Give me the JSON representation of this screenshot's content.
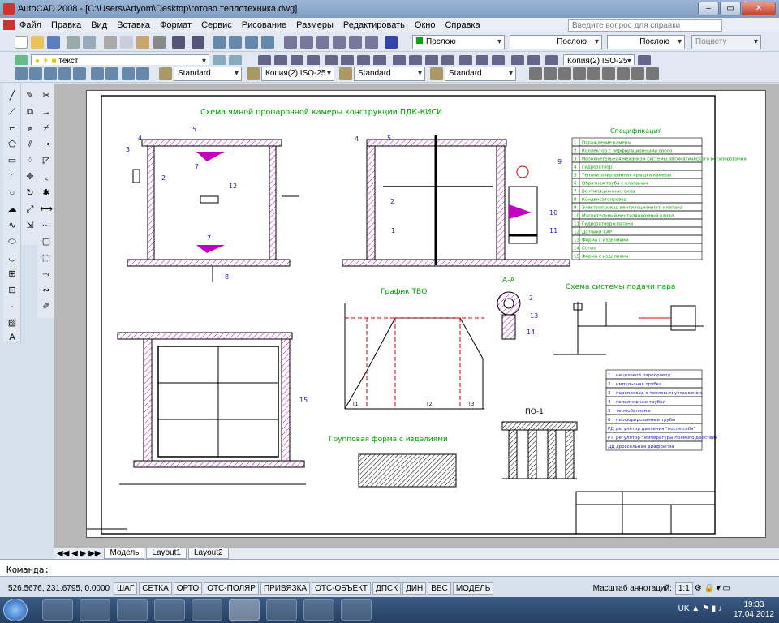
{
  "window": {
    "title": "AutoCAD 2008 - [C:\\Users\\Artyom\\Desktop\\готово теплотехника.dwg]"
  },
  "menu": {
    "items": [
      "Файл",
      "Правка",
      "Вид",
      "Вставка",
      "Формат",
      "Сервис",
      "Рисование",
      "Размеры",
      "Редактировать",
      "Окно",
      "Справка"
    ],
    "help_placeholder": "Введите вопрос для справки"
  },
  "toolbar": {
    "layer_color": "Послою",
    "linetype": "Послою",
    "lineweight": "Послою",
    "plotstyle": "Поцвету",
    "layer_name": "текст",
    "dimstyle_right": "Копия(2) ISO-25",
    "textstyle": "Standard",
    "dimstyle": "Копия(2) ISO-25",
    "tablestyle": "Standard",
    "mleaderstyle": "Standard"
  },
  "drawing": {
    "title_main": "Схема ямной пропарочной камеры конструкции ПДК-КИСИ",
    "spec_title": "Спецификация",
    "spec_rows": [
      {
        "n": "1",
        "t": "Ограждение камеры"
      },
      {
        "n": "2",
        "t": "Коллектор с перфорационными сопло"
      },
      {
        "n": "3",
        "t": "Исполнительная механизм системы автоматического регулирования"
      },
      {
        "n": "4",
        "t": "Гидрозатвор"
      },
      {
        "n": "5",
        "t": "Теплоизолированная крышка камеры"
      },
      {
        "n": "6",
        "t": "Обратная труба с клапаном"
      },
      {
        "n": "7",
        "t": "Вентиляционные окна"
      },
      {
        "n": "8",
        "t": "Конденсатопровод"
      },
      {
        "n": "9",
        "t": "Электропривод вентиляционного клапана"
      },
      {
        "n": "10",
        "t": "Магнительный вентиляционный канал"
      },
      {
        "n": "11",
        "t": "Гидрозатвор клапана"
      },
      {
        "n": "12",
        "t": "Датчики САР"
      },
      {
        "n": "13",
        "t": "Форма с изделиями"
      },
      {
        "n": "14",
        "t": "Сопло"
      },
      {
        "n": "15",
        "t": "Форма с изделиями"
      }
    ],
    "graph_title": "График ТВО",
    "section_aa": "А-А",
    "steam_title": "Схема системы подачи пара",
    "legend2": [
      {
        "n": "1",
        "t": "нецеховой паропровод"
      },
      {
        "n": "2",
        "t": "импульсная трубка"
      },
      {
        "n": "3",
        "t": "паропровод к тепловым установкам"
      },
      {
        "n": "4",
        "t": "капиллярные трубки"
      },
      {
        "n": "5",
        "t": "термобаллоны"
      },
      {
        "n": "6",
        "t": "перфорированные трубы"
      },
      {
        "n": "РД",
        "t": "регулятор давления \"после себя\""
      },
      {
        "n": "РТ",
        "t": "регулятор температуры прямого действия"
      },
      {
        "n": "ДД",
        "t": "дроссельная диафрагма"
      }
    ],
    "group_form": "Групповая форма с изделиями",
    "po1": "ПО-1",
    "graph_t_labels": [
      "T1",
      "T2",
      "T3"
    ]
  },
  "tabs": [
    "Модель",
    "Layout1",
    "Layout2"
  ],
  "command": {
    "prompt": "Команда:"
  },
  "status": {
    "coords": "526.5676, 231.6795, 0.0000",
    "buttons": [
      "ШАГ",
      "СЕТКА",
      "ОРТО",
      "ОТС-ПОЛЯР",
      "ПРИВЯЗКА",
      "ОТС-ОБЪЕКТ",
      "ДПСК",
      "ДИН",
      "ВЕС",
      "МОДЕЛЬ"
    ],
    "annot_label": "Масштаб аннотаций:",
    "annot_value": "1:1"
  },
  "taskbar": {
    "lang": "UK",
    "time": "19:33",
    "date": "17.04.2012"
  },
  "colors": {
    "accent_green": "#00a000",
    "hatch_magenta": "#c000c0",
    "dim_blue": "#2020c0",
    "red": "#d00000"
  }
}
